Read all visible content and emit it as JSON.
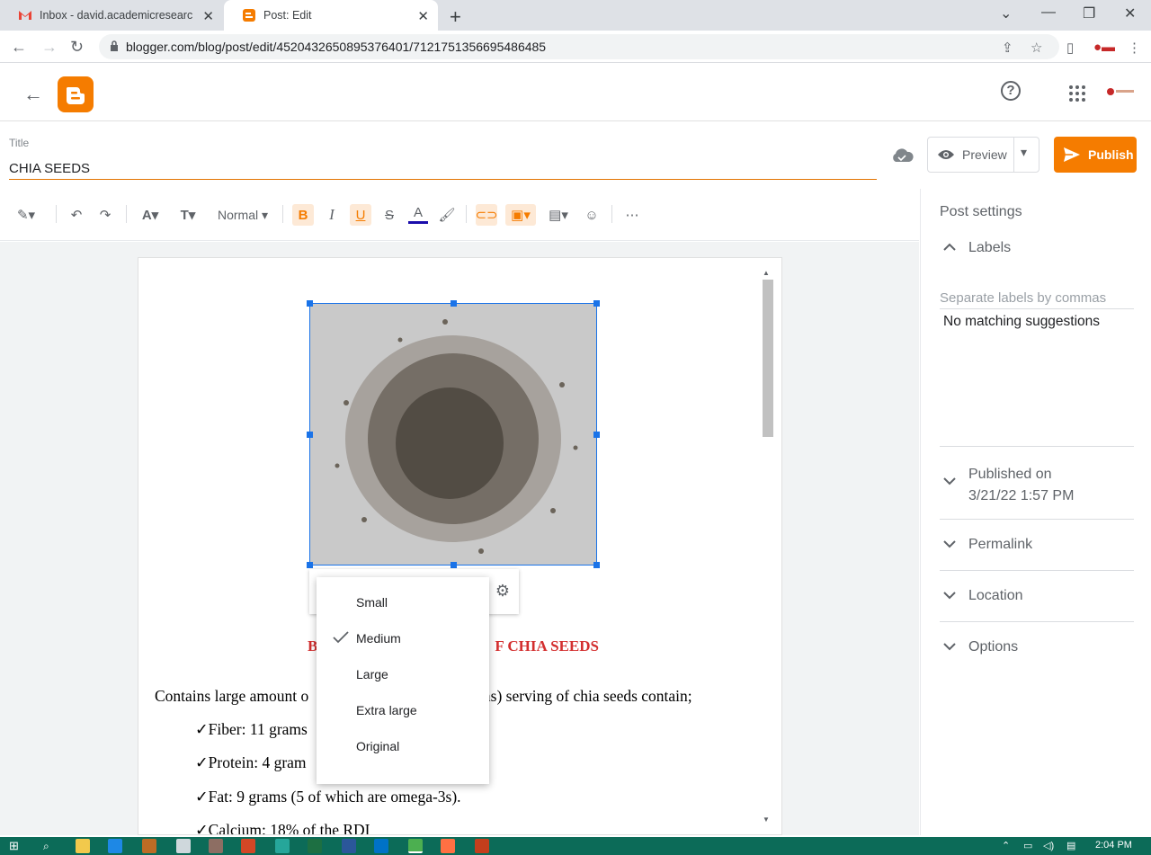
{
  "browser": {
    "tabs": [
      {
        "title": "Inbox - david.academicresearche",
        "favicon": "gmail-icon"
      },
      {
        "title": "Post: Edit",
        "favicon": "blogger-icon"
      }
    ],
    "url": "blogger.com/blog/post/edit/4520432650895376401/7121751356695486485"
  },
  "appbar": {
    "back": "back-arrow-icon",
    "help": "?"
  },
  "title_field": {
    "label": "Title",
    "value": "CHIA SEEDS"
  },
  "actions": {
    "preview": "Preview",
    "publish": "Publish"
  },
  "toolbar": {
    "paragraph_style": "Normal"
  },
  "document": {
    "heading": "BENEFITS OF CHIA SEEDS",
    "heading_visible_left": "B",
    "heading_visible_right": "F CHIA SEEDS",
    "paragraph_left": "Contains large amount o",
    "paragraph_right": "ams) serving of chia seeds contain;",
    "bullets": [
      "Fiber: 11 grams",
      "Protein: 4 gram",
      "Fat: 9 grams (5 of which are omega-3s).",
      "Calcium: 18% of the RDI"
    ]
  },
  "size_menu": {
    "items": [
      "Small",
      "Medium",
      "Large",
      "Extra large",
      "Original"
    ],
    "selected": "Medium"
  },
  "post_settings": {
    "title": "Post settings",
    "labels_header": "Labels",
    "labels_placeholder": "Separate labels by commas",
    "no_match": "No matching suggestions",
    "published_header": "Published on",
    "published_date": "3/21/22 1:57 PM",
    "permalink": "Permalink",
    "location": "Location",
    "options": "Options"
  },
  "taskbar": {
    "time": "2:04 PM"
  },
  "colors": {
    "accent": "#f57c00",
    "selection": "#1a73e8",
    "heading_red": "#d32f2f",
    "taskbar": "#0c6b58"
  }
}
